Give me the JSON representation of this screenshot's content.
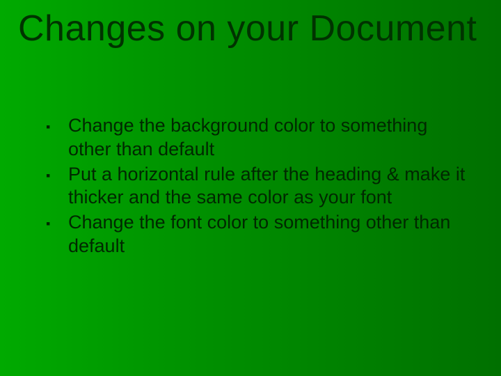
{
  "title": "Changes on your Document",
  "bullets": [
    "Change the background color to something other than default",
    "Put a horizontal rule after the heading & make it thicker and the same color as your font",
    "Change the font color to something other than default"
  ]
}
